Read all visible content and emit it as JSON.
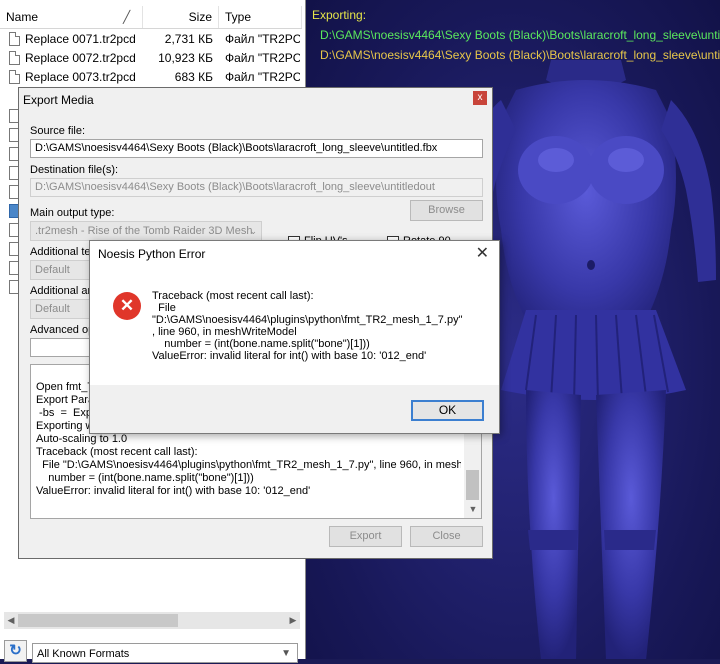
{
  "browser": {
    "columns": {
      "name": "Name",
      "size": "Size",
      "type": "Type"
    },
    "files": [
      {
        "name": "Replace 0071.tr2pcd",
        "size": "2,731 КБ",
        "type": "Файл \"TR2PCD\""
      },
      {
        "name": "Replace 0072.tr2pcd",
        "size": "10,923 КБ",
        "type": "Файл \"TR2PCD\""
      },
      {
        "name": "Replace 0073.tr2pcd",
        "size": "683 КБ",
        "type": "Файл \"TR2PCD\""
      }
    ],
    "format_filter": "All Known Formats"
  },
  "viewport": {
    "status": "Exporting:",
    "line1": "D:\\GAMS\\noesisv4464\\Sexy Boots (Black)\\Boots\\laracroft_long_sleeve\\untitled.fbx",
    "line2": "D:\\GAMS\\noesisv4464\\Sexy Boots (Black)\\Boots\\laracroft_long_sleeve\\untitledout"
  },
  "export_dialog": {
    "title": "Export Media",
    "source_label": "Source file:",
    "source_value": "D:\\GAMS\\noesisv4464\\Sexy Boots (Black)\\Boots\\laracroft_long_sleeve\\untitled.fbx",
    "dest_label": "Destination file(s):",
    "dest_value": "D:\\GAMS\\noesisv4464\\Sexy Boots (Black)\\Boots\\laracroft_long_sleeve\\untitledout",
    "browse": "Browse",
    "main_type_label": "Main output type:",
    "main_type_value": ".tr2mesh - Rise of the Tomb Raider 3D Mesh",
    "additional_tex_label": "Additional te",
    "additional_tex_value": "Default",
    "additional_anim_label": "Additional ar",
    "additional_anim_value": "Default",
    "advanced_label": "Advanced op",
    "flip_uvs": "Flip UV's",
    "rotate_90": "Rotate 90",
    "log": "Open fmt_T\nExport Para\n -bs  =  Exp\nExporting w\nAuto-scaling to 1.0\nTraceback (most recent call last):\n  File \"D:\\GAMS\\noesisv4464\\plugins\\python\\fmt_TR2_mesh_1_7.py\", line 960, in meshW\n    number = (int(bone.name.split(\"bone\")[1]))\nValueError: invalid literal for int() with base 10: '012_end'",
    "export_btn": "Export",
    "close_btn": "Close"
  },
  "error_dialog": {
    "title": "Noesis Python Error",
    "message": "Traceback (most recent call last):\n  File\n\"D:\\GAMS\\noesisv4464\\plugins\\python\\fmt_TR2_mesh_1_7.py\"\n, line 960, in meshWriteModel\n    number = (int(bone.name.split(\"bone\")[1]))\nValueError: invalid literal for int() with base 10: '012_end'",
    "ok": "OK"
  },
  "colors": {
    "viewport_bg": "#181858",
    "status_yellow": "#e6e64a",
    "path_green": "#5ce85c",
    "error_red": "#e0362a",
    "focus_blue": "#3c7fd0"
  }
}
